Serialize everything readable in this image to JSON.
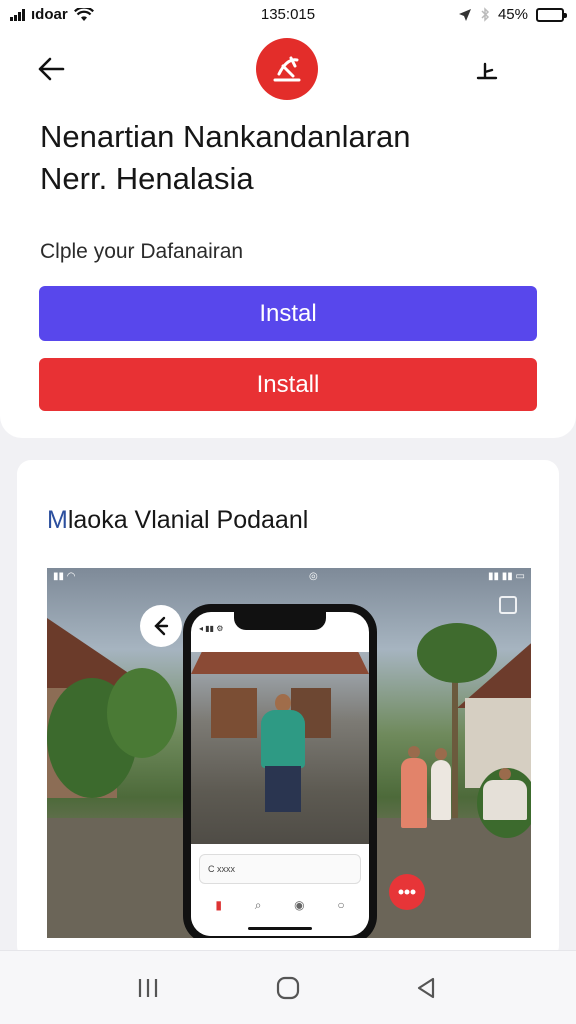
{
  "status_bar": {
    "carrier": "ıdoar",
    "time": "135:015",
    "battery": "45%",
    "battery_level": 0.45,
    "icons": [
      "signal-bars-icon",
      "wifi-icon",
      "location-icon",
      "bluetooth-icon",
      "battery-icon"
    ]
  },
  "header": {
    "back_icon": "back-arrow-icon",
    "logo_icon": "app-logo-icon",
    "share_icon": "share-icon"
  },
  "app": {
    "title_line1": "Nenartian Nankandanlaran",
    "title_line2": "Nerr. Henalasia",
    "subtitle": "Clple your Dafanairan"
  },
  "buttons": {
    "primary_label": "Instal",
    "secondary_label": "Install",
    "primary_color": "#5847ec",
    "secondary_color": "#e83134"
  },
  "preview": {
    "title_first": "M",
    "title_rest": "laoka Vlanial Podaanl",
    "screenshot": {
      "phone_search_text": "C xxxx"
    }
  },
  "system_nav": {
    "icons": [
      "recent-apps-icon",
      "home-icon",
      "back-triangle-icon"
    ]
  }
}
